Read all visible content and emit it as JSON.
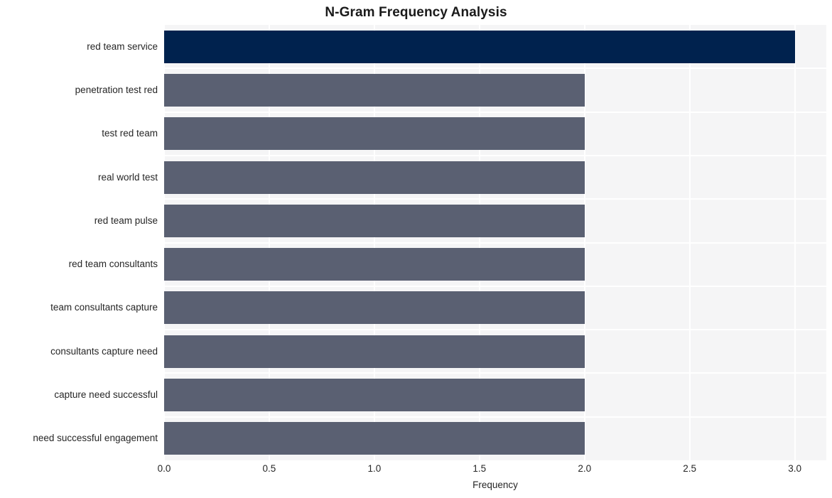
{
  "chart_data": {
    "type": "bar",
    "orientation": "horizontal",
    "title": "N-Gram Frequency Analysis",
    "xlabel": "Frequency",
    "ylabel": "",
    "categories": [
      "red team service",
      "penetration test red",
      "test red team",
      "real world test",
      "red team pulse",
      "red team consultants",
      "team consultants capture",
      "consultants capture need",
      "capture need successful",
      "need successful engagement"
    ],
    "values": [
      3,
      2,
      2,
      2,
      2,
      2,
      2,
      2,
      2,
      2
    ],
    "bar_colors": [
      "#00224e",
      "#5a6072",
      "#5a6072",
      "#5a6072",
      "#5a6072",
      "#5a6072",
      "#5a6072",
      "#5a6072",
      "#5a6072",
      "#5a6072"
    ],
    "xlim": [
      0,
      3.15
    ],
    "xticks": [
      0,
      0.5,
      1,
      1.5,
      2,
      2.5,
      3
    ],
    "xticklabels": [
      "0.0",
      "0.5",
      "1.0",
      "1.5",
      "2.0",
      "2.5",
      "3.0"
    ],
    "grid": true,
    "grid_color": "#ffffff",
    "plot_background": "#f5f5f6",
    "figure_background": "#ffffff",
    "legend": null
  }
}
